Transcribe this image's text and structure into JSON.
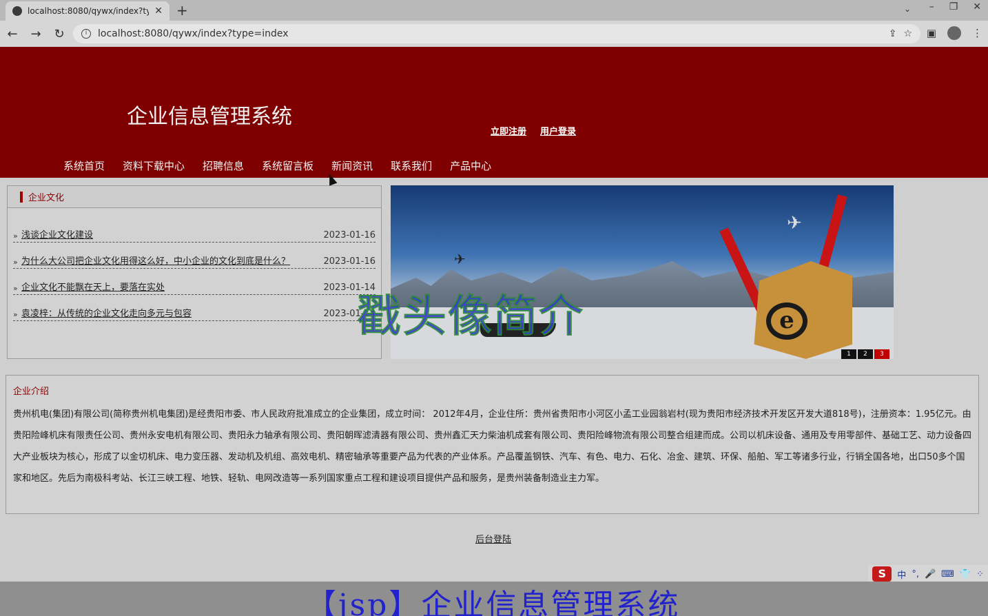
{
  "browser": {
    "tab_title": "localhost:8080/qywx/index?ty",
    "tab_close": "✕",
    "new_tab": "+",
    "url": "localhost:8080/qywx/index?type=index"
  },
  "header": {
    "site_title": "企业信息管理系统",
    "register_label": "立即注册",
    "login_label": "用户登录",
    "nav": [
      "系统首页",
      "资料下载中心",
      "招聘信息",
      "系统留言板",
      "新闻资讯",
      "联系我们",
      "产品中心"
    ]
  },
  "culture": {
    "heading": "企业文化",
    "items": [
      {
        "bullet": "»",
        "title": "浅谈企业文化建设",
        "date": "2023-01-16"
      },
      {
        "bullet": "»",
        "title": "为什么大公司把企业文化用得这么好，中小企业的文化到底是什么？",
        "date": "2023-01-16"
      },
      {
        "bullet": "»",
        "title": "企业文化不能飘在天上，要落在实处",
        "date": "2023-01-14"
      },
      {
        "bullet": "»",
        "title": "袁凌梓：从传统的企业文化走向多元与包容",
        "date": "2023-01-14"
      }
    ]
  },
  "banner": {
    "slides": [
      "1",
      "2",
      "3"
    ],
    "active_slide": "3",
    "logo_letter": "e"
  },
  "overlay_title": "戳头像简介",
  "intro": {
    "heading": "企业介绍",
    "body": "贵州机电(集团)有限公司(简称贵州机电集团)是经贵阳市委、市人民政府批准成立的企业集团，成立时间： 2012年4月，企业住所：贵州省贵阳市小河区小孟工业园翁岩村(现为贵阳市经济技术开发区开发大道818号)，注册资本：1.95亿元。由贵阳险峰机床有限责任公司、贵州永安电机有限公司、贵阳永力轴承有限公司、贵阳朝晖滤清器有限公司、贵州鑫汇天力柴油机成套有限公司、贵阳险峰物流有限公司整合组建而成。公司以机床设备、通用及专用零部件、基础工艺、动力设备四大产业板块为核心，形成了以金切机床、电力变压器、发动机及机组、高效电机、精密轴承等重要产品为代表的产业体系。产品覆盖钢铁、汽车、有色、电力、石化、冶金、建筑、环保、船舶、军工等诸多行业，行销全国各地，出口50多个国家和地区。先后为南极科考站、长江三峡工程、地铁、轻轨、电网改造等一系列国家重点工程和建设项目提供产品和服务，是贵州装备制造业主力军。"
  },
  "footer": {
    "admin_login": "后台登陆",
    "caption": "【jsp】企业信息管理系统"
  },
  "ime": {
    "logo": "S",
    "items": [
      "中",
      "°,",
      "🎤",
      "⌨",
      "👕",
      "⁘"
    ]
  }
}
